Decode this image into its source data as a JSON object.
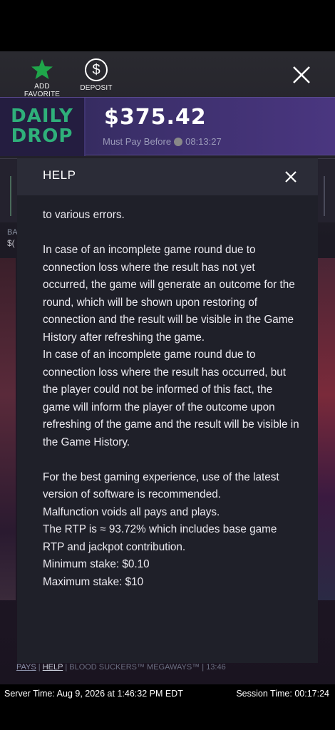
{
  "toolbar": {
    "favorite_label": "ADD FAVORITE",
    "deposit_label": "DEPOSIT"
  },
  "daily_drop": {
    "logo_line1": "DAILY",
    "logo_line2": "DROP",
    "amount": "$375.42",
    "must_pay_label": "Must Pay Before",
    "countdown": "08:13:27"
  },
  "background": {
    "ba_label": "BA",
    "ba_value": "$("
  },
  "help": {
    "title": "HELP",
    "paragraphs": [
      "to various errors.",
      "",
      "In case of an incomplete game round due to connection loss where the result has not yet occurred, the game will generate an outcome for the round, which will be shown upon restoring of connection and the result will be visible in the Game History after refreshing the game.",
      "In case of an incomplete game round due to connection loss where the result has occurred, but the player could not be informed of this fact, the game will inform the player of the outcome upon refreshing of the game and the result will be visible in the Game History.",
      "",
      "For the best gaming experience, use of the latest version of software is recommended.",
      "Malfunction voids all pays and plays.",
      "The RTP is ≈ 93.72% which includes base game RTP and jackpot contribution.",
      "Minimum stake: $0.10",
      "Maximum stake: $10"
    ]
  },
  "footer": {
    "pays": "PAYS",
    "help": "HELP",
    "game_name": "BLOOD SUCKERS™ MEGAWAYS™",
    "time": "13:46",
    "separator": "|"
  },
  "server": {
    "server_time_label": "Server Time:",
    "server_time_value": "Aug 9, 2026 at 1:46:32 PM EDT",
    "session_time_label": "Session Time:",
    "session_time_value": "00:17:24"
  },
  "colors": {
    "accent_green": "#2fb07a",
    "modal_bg": "#1f2029",
    "modal_header": "#2b2c37"
  }
}
